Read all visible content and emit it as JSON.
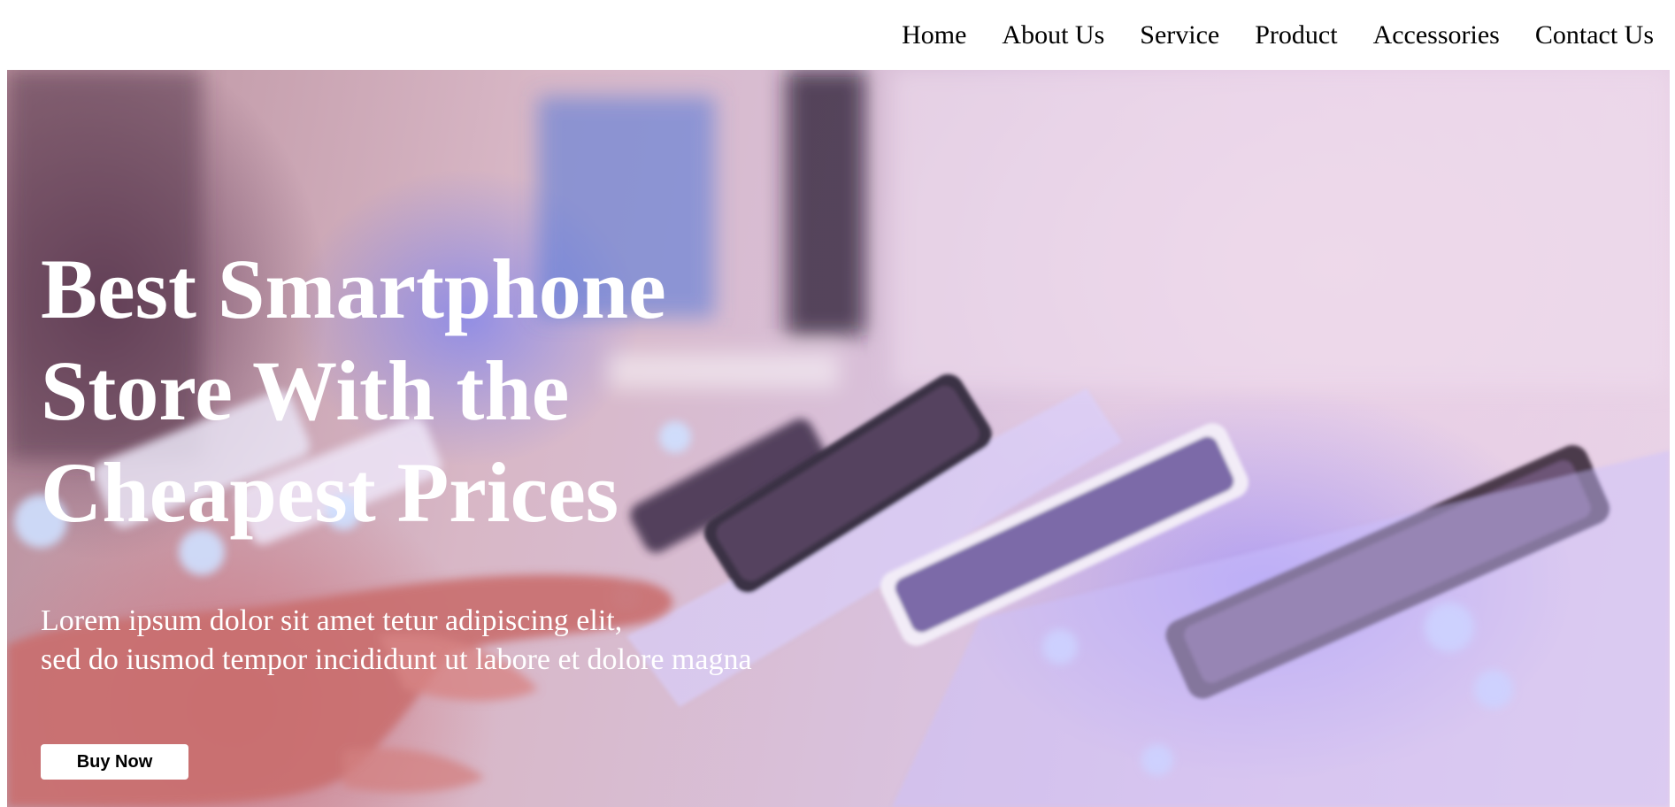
{
  "nav": {
    "items": [
      {
        "label": "Home"
      },
      {
        "label": "About Us"
      },
      {
        "label": "Service"
      },
      {
        "label": "Product"
      },
      {
        "label": "Accessories"
      },
      {
        "label": "Contact Us"
      }
    ]
  },
  "hero": {
    "title": "Best Smartphone Store With the Cheapest Prices",
    "subtitle_line1": "Lorem ipsum dolor sit amet tetur adipiscing elit,",
    "subtitle_line2": "sed do iusmod tempor incididunt ut labore et dolore magna",
    "button_label": "Buy Now",
    "image_description_icon": "smartphones-on-display-photo"
  },
  "colors": {
    "nav_text": "#000000",
    "hero_text": "#ffffff",
    "button_bg": "#ffffff",
    "button_text": "#000000"
  }
}
